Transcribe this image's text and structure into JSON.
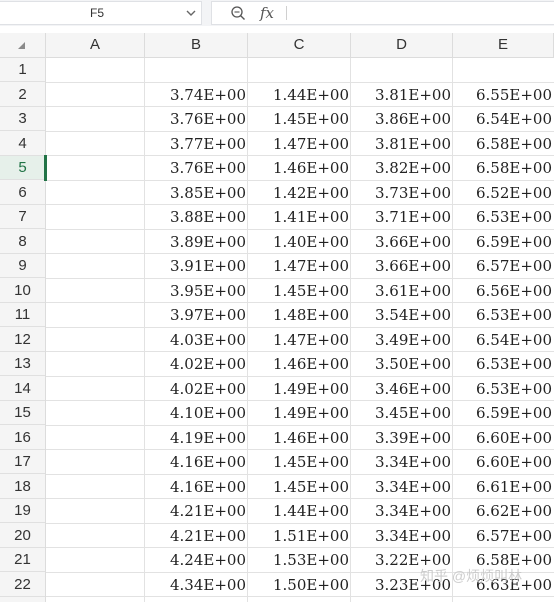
{
  "name_box": {
    "cell_ref": "F5"
  },
  "formula_bar": {
    "fx_label": "fx",
    "value": ""
  },
  "columns": [
    "A",
    "B",
    "C",
    "D",
    "E"
  ],
  "selected_row": "5",
  "rows": [
    {
      "num": "1",
      "cells": [
        "",
        "",
        "",
        "",
        ""
      ]
    },
    {
      "num": "2",
      "cells": [
        "",
        "3.74E+00",
        "1.44E+00",
        "3.81E+00",
        "6.55E+00"
      ]
    },
    {
      "num": "3",
      "cells": [
        "",
        "3.76E+00",
        "1.45E+00",
        "3.86E+00",
        "6.54E+00"
      ]
    },
    {
      "num": "4",
      "cells": [
        "",
        "3.77E+00",
        "1.47E+00",
        "3.81E+00",
        "6.58E+00"
      ]
    },
    {
      "num": "5",
      "cells": [
        "",
        "3.76E+00",
        "1.46E+00",
        "3.82E+00",
        "6.58E+00"
      ]
    },
    {
      "num": "6",
      "cells": [
        "",
        "3.85E+00",
        "1.42E+00",
        "3.73E+00",
        "6.52E+00"
      ]
    },
    {
      "num": "7",
      "cells": [
        "",
        "3.88E+00",
        "1.41E+00",
        "3.71E+00",
        "6.53E+00"
      ]
    },
    {
      "num": "8",
      "cells": [
        "",
        "3.89E+00",
        "1.40E+00",
        "3.66E+00",
        "6.59E+00"
      ]
    },
    {
      "num": "9",
      "cells": [
        "",
        "3.91E+00",
        "1.47E+00",
        "3.66E+00",
        "6.57E+00"
      ]
    },
    {
      "num": "10",
      "cells": [
        "",
        "3.95E+00",
        "1.45E+00",
        "3.61E+00",
        "6.56E+00"
      ]
    },
    {
      "num": "11",
      "cells": [
        "",
        "3.97E+00",
        "1.48E+00",
        "3.54E+00",
        "6.53E+00"
      ]
    },
    {
      "num": "12",
      "cells": [
        "",
        "4.03E+00",
        "1.47E+00",
        "3.49E+00",
        "6.54E+00"
      ]
    },
    {
      "num": "13",
      "cells": [
        "",
        "4.02E+00",
        "1.46E+00",
        "3.50E+00",
        "6.53E+00"
      ]
    },
    {
      "num": "14",
      "cells": [
        "",
        "4.02E+00",
        "1.49E+00",
        "3.46E+00",
        "6.53E+00"
      ]
    },
    {
      "num": "15",
      "cells": [
        "",
        "4.10E+00",
        "1.49E+00",
        "3.45E+00",
        "6.59E+00"
      ]
    },
    {
      "num": "16",
      "cells": [
        "",
        "4.19E+00",
        "1.46E+00",
        "3.39E+00",
        "6.60E+00"
      ]
    },
    {
      "num": "17",
      "cells": [
        "",
        "4.16E+00",
        "1.45E+00",
        "3.34E+00",
        "6.60E+00"
      ]
    },
    {
      "num": "18",
      "cells": [
        "",
        "4.16E+00",
        "1.45E+00",
        "3.34E+00",
        "6.61E+00"
      ]
    },
    {
      "num": "19",
      "cells": [
        "",
        "4.21E+00",
        "1.44E+00",
        "3.34E+00",
        "6.62E+00"
      ]
    },
    {
      "num": "20",
      "cells": [
        "",
        "4.21E+00",
        "1.51E+00",
        "3.34E+00",
        "6.57E+00"
      ]
    },
    {
      "num": "21",
      "cells": [
        "",
        "4.24E+00",
        "1.53E+00",
        "3.22E+00",
        "6.58E+00"
      ]
    },
    {
      "num": "22",
      "cells": [
        "",
        "4.34E+00",
        "1.50E+00",
        "3.23E+00",
        "6.63E+00"
      ]
    }
  ],
  "watermark": "知乎 @烦烦叫林",
  "colors": {
    "accent": "#217346",
    "header_bg": "#f5f5f5",
    "grid_line": "#e2e2e2"
  },
  "icons": {
    "name_box_dropdown": "chevron-down-icon",
    "zoom": "zoom-icon",
    "function": "fx-icon"
  }
}
